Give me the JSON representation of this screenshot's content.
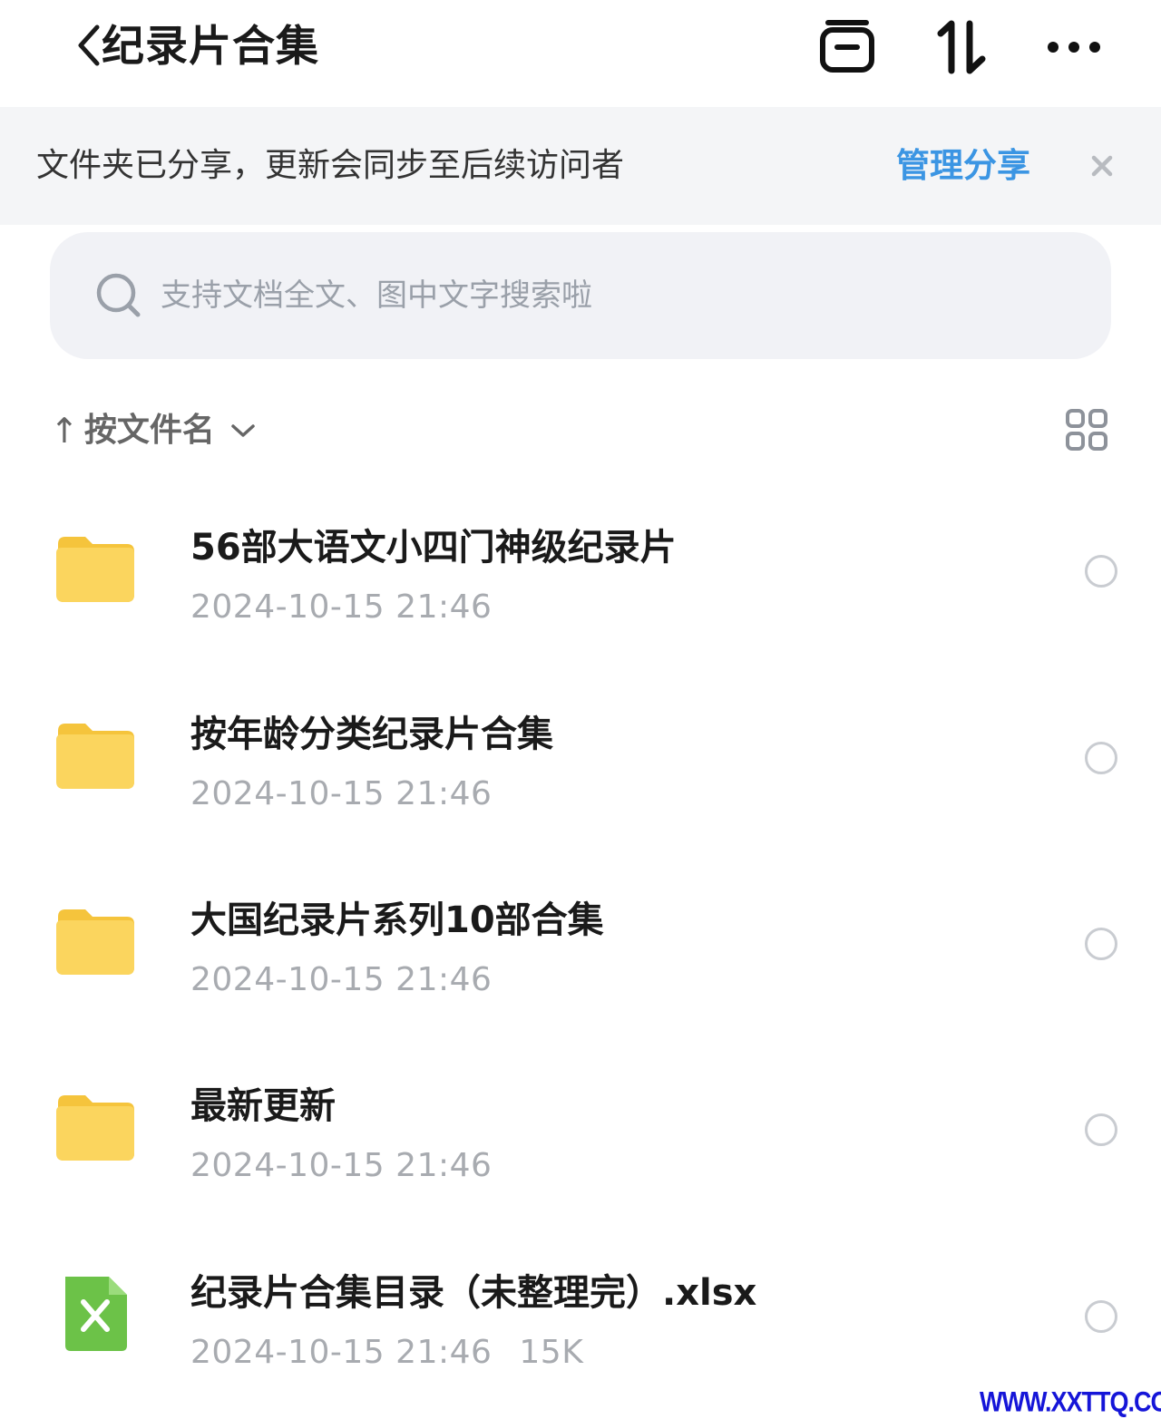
{
  "header": {
    "title": "纪录片合集",
    "icons": [
      "back-icon",
      "multi-select-icon",
      "transfer-icon",
      "more-icon"
    ]
  },
  "banner": {
    "message": "文件夹已分享，更新会同步至后续访问者",
    "link": "管理分享",
    "link_color": "#3b95e3"
  },
  "search": {
    "placeholder": "支持文档全文、图中文字搜索啦"
  },
  "sort": {
    "arrow": "↑",
    "label": "按文件名"
  },
  "files": [
    {
      "name": "56部大语文小四门神级纪录片",
      "date": "2024-10-15 21:46",
      "size": "",
      "type": "folder"
    },
    {
      "name": "按年龄分类纪录片合集",
      "date": "2024-10-15 21:46",
      "size": "",
      "type": "folder"
    },
    {
      "name": "大国纪录片系列10部合集",
      "date": "2024-10-15 21:46",
      "size": "",
      "type": "folder"
    },
    {
      "name": "最新更新",
      "date": "2024-10-15 21:46",
      "size": "",
      "type": "folder"
    },
    {
      "name": "纪录片合集目录（未整理完）.xlsx",
      "date": "2024-10-15 21:46",
      "size": "15K",
      "type": "xlsx"
    }
  ],
  "watermark": "WWW.XXTTQ.COM",
  "colors": {
    "folder": "#fbd55e",
    "excel": "#6cc248",
    "muted_text": "#a8abb0"
  }
}
